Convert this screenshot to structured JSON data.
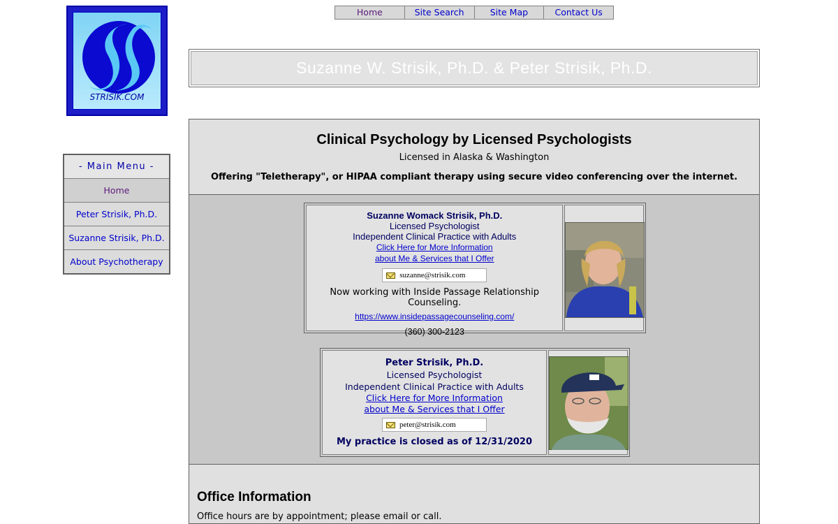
{
  "logo": {
    "text": "STRISIK.COM"
  },
  "topnav": [
    "Home",
    "Site Search",
    "Site Map",
    "Contact Us"
  ],
  "banner": {
    "title": "Suzanne W. Strisik, Ph.D. & Peter Strisik, Ph.D."
  },
  "sidemenu": {
    "heading": "- Main Menu -",
    "items": [
      "Home",
      "Peter Strisik, Ph.D.",
      "Suzanne Strisik, Ph.D.",
      "About Psychotherapy"
    ]
  },
  "intro": {
    "heading": "Clinical Psychology by Licensed Psychologists",
    "licensed": "Licensed in Alaska & Washington",
    "offering": "Offering \"Teletherapy\", or HIPAA compliant therapy using secure video conferencing over the internet."
  },
  "suzanne": {
    "name": "Suzanne Womack Strisik, Ph.D.",
    "title": "Licensed Psychologist",
    "practice": "Independent Clinical Practice with Adults",
    "link1": "Click Here for More Information",
    "link2": "about Me & Services that I Offer",
    "email": "suzanne@strisik.com",
    "working": "Now working with Inside Passage Relationship Counseling.",
    "url": "https://www.insidepassagecounseling.com/",
    "phone": "(360) 300-2123"
  },
  "peter": {
    "name": "Peter Strisik, Ph.D.",
    "title": "Licensed Psychologist",
    "practice": "Independent Clinical Practice with Adults",
    "link1": "Click Here for More Information",
    "link2": "about Me & Services that I Offer",
    "email": "peter@strisik.com",
    "closed": "My practice is closed as of 12/31/2020"
  },
  "office": {
    "heading": "Office Information",
    "hours": "Office hours are by appointment; please email or call."
  },
  "colors": {
    "link": "#0000cc",
    "visited": "#5a1a7a",
    "panel": "#e0e0e0",
    "accent_name": "#000060"
  }
}
